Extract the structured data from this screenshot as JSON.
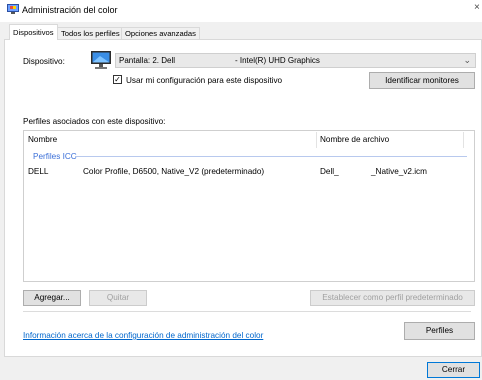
{
  "window": {
    "title": "Administración del color",
    "close_glyph": "×"
  },
  "tabs": [
    {
      "label": "Dispositivos",
      "active": true
    },
    {
      "label": "Todos los perfiles",
      "active": false
    },
    {
      "label": "Opciones avanzadas",
      "active": false
    }
  ],
  "device": {
    "label": "Dispositivo:",
    "selected_name": "Pantalla: 2. Dell",
    "selected_adapter": "- Intel(R) UHD Graphics",
    "use_my_settings_checked": true,
    "use_my_settings_label": "Usar mi configuración para este dispositivo",
    "identify_button": "Identificar monitores"
  },
  "profiles": {
    "section_label": "Perfiles asociados con este dispositivo:",
    "columns": [
      "Nombre",
      "Nombre de archivo"
    ],
    "group_label": "Perfiles ICC",
    "rows": [
      {
        "name_prefix": "DELL",
        "name_suffix": "Color Profile, D6500, Native_V2 (predeterminado)",
        "file_prefix": "Dell_",
        "file_suffix": "_Native_v2.icm"
      }
    ]
  },
  "actions": {
    "add": "Agregar...",
    "remove": "Quitar",
    "set_default": "Establecer como perfil predeterminado",
    "profiles": "Perfiles",
    "close": "Cerrar"
  },
  "info_link": "Información acerca de la configuración de administración del color",
  "colors": {
    "link": "#0066cc",
    "accent_group": "#3b6fd8"
  }
}
